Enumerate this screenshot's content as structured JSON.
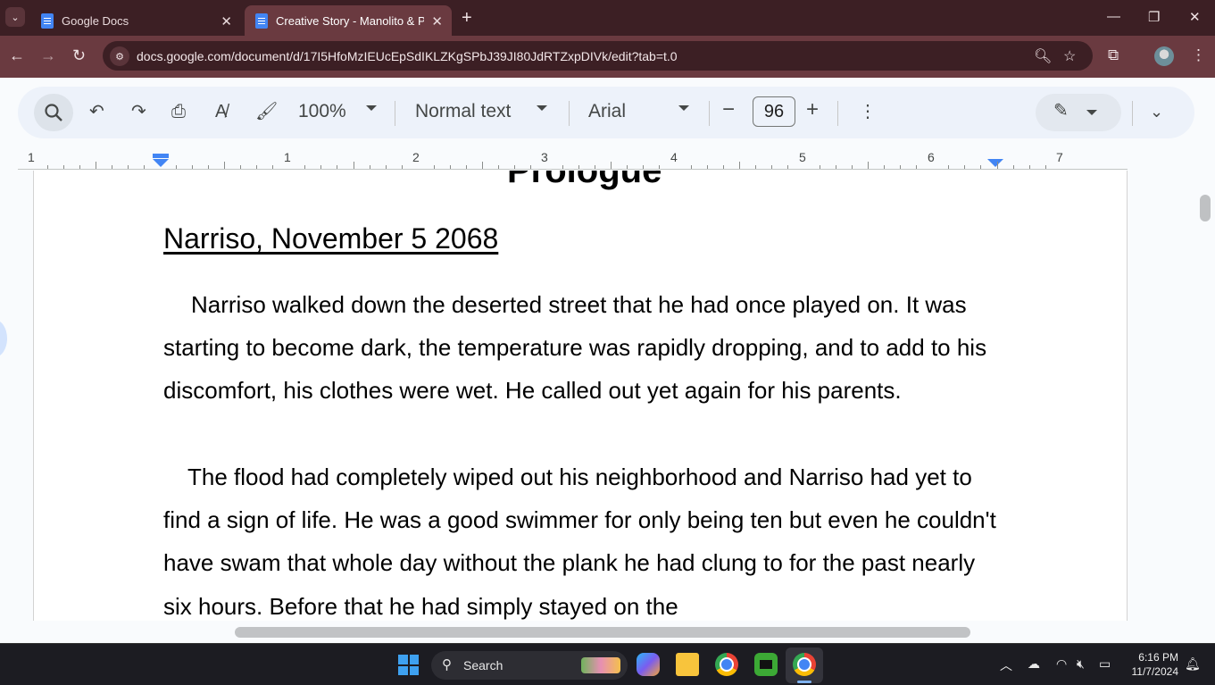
{
  "browser": {
    "tabs": [
      {
        "title": "Google Docs",
        "active": false
      },
      {
        "title": "Creative Story - Manolito & Pru",
        "active": true
      }
    ],
    "url": "docs.google.com/document/d/17I5HfoMzIEUcEpSdIKLZKgSPbJ39JI80JdRTZxpDIVk/edit?tab=t.0",
    "colors": {
      "frame": "#3c1f24",
      "toolbar": "#6a3a40"
    }
  },
  "docs_toolbar": {
    "zoom": "100%",
    "style": "Normal text",
    "font": "Arial",
    "font_size": "96",
    "icons": [
      "search-icon",
      "undo-icon",
      "redo-icon",
      "print-icon",
      "spellcheck-icon",
      "paint-format-icon",
      "decrease-icon",
      "increase-icon",
      "more-icon",
      "pencil-icon",
      "collapse-icon"
    ]
  },
  "ruler": {
    "numbers": [
      "1",
      "1",
      "2",
      "3",
      "4",
      "5",
      "6",
      "7"
    ]
  },
  "document": {
    "cut_heading": "Prologue",
    "heading": "Narriso, November 5 2068",
    "paragraphs": [
      "Narriso walked down the deserted street that he had once played on. It was starting to become dark, the temperature was rapidly dropping, and to add to his discomfort, his clothes were wet. He called out yet again for his parents.",
      "The flood had completely wiped out his neighborhood and Narriso had yet to find a sign of life. He was a good swimmer for only being ten but even he couldn't have swam that whole day without the plank he had clung to for the past nearly six hours. Before that he had simply stayed on the"
    ]
  },
  "taskbar": {
    "search_label": "Search",
    "time": "6:16 PM",
    "date": "11/7/2024"
  }
}
